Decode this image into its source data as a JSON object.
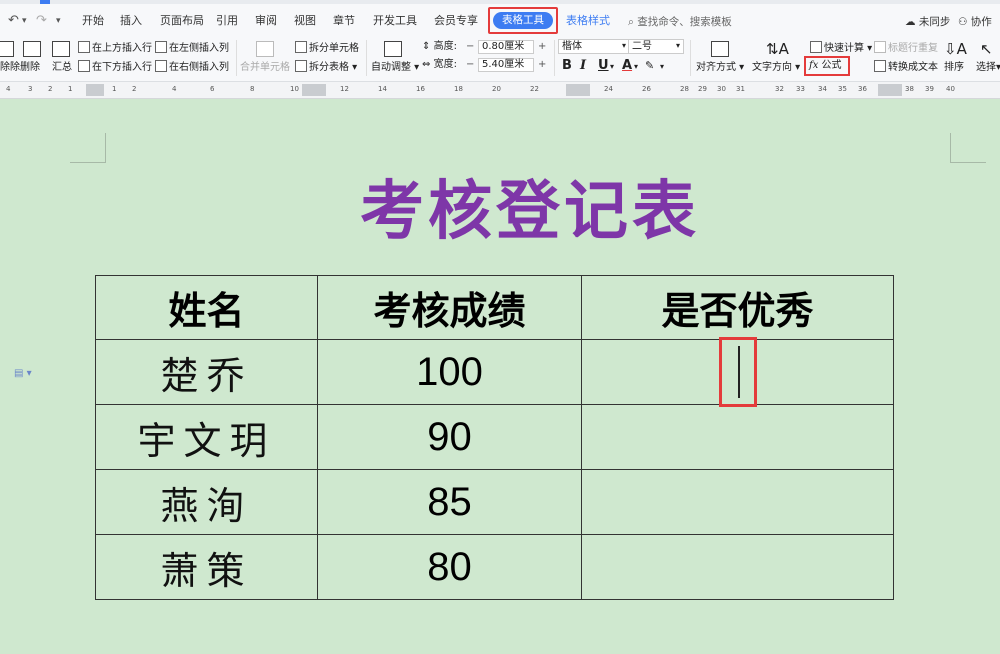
{
  "ribbon": {
    "tabs": [
      "开始",
      "插入",
      "页面布局",
      "引用",
      "审阅",
      "视图",
      "章节",
      "开发工具",
      "会员专享"
    ],
    "active_tab": "表格工具",
    "table_style_tab": "表格样式",
    "search_placeholder": "查找命令、搜索模板",
    "sync_label": "未同步",
    "collab_label": "协作",
    "tools": {
      "delete_partial": "除除",
      "delete": "删除",
      "summary": "汇总",
      "insert_row_above": "在上方插入行",
      "insert_row_below": "在下方插入行",
      "insert_col_left": "在左侧插入列",
      "insert_col_right": "在右侧插入列",
      "merge_cells": "合并单元格",
      "split_cells": "拆分单元格",
      "split_table": "拆分表格",
      "auto_adjust": "自动调整",
      "height_label": "高度:",
      "height_value": "0.80厘米",
      "width_label": "宽度:",
      "width_value": "5.40厘米",
      "font_name": "楷体",
      "font_size": "二号",
      "align": "对齐方式",
      "text_direction": "文字方向",
      "quick_calc": "快速计算",
      "formula": "公式",
      "header_repeat": "标题行重复",
      "convert_to_text": "转换成文本",
      "sort": "排序",
      "select": "选择"
    },
    "accent_color": "#3d7cf2",
    "highlight_color": "#e43b3b"
  },
  "ruler": {
    "marks": [
      "4",
      "3",
      "2",
      "1",
      "1",
      "2",
      "4",
      "6",
      "8",
      "10",
      "12",
      "14",
      "16",
      "18",
      "20",
      "22",
      "24",
      "26",
      "28",
      "29",
      "30",
      "31",
      "32",
      "33",
      "34",
      "35",
      "36",
      "38",
      "39",
      "40"
    ]
  },
  "document": {
    "title": "考核登记表",
    "title_color": "#7e36a8",
    "headers": [
      "姓名",
      "考核成绩",
      "是否优秀"
    ],
    "rows": [
      {
        "name": "楚乔",
        "score": "100",
        "excellent": ""
      },
      {
        "name": "宇文玥",
        "score": "90",
        "excellent": ""
      },
      {
        "name": "燕洵",
        "score": "85",
        "excellent": ""
      },
      {
        "name": "萧策",
        "score": "80",
        "excellent": ""
      }
    ]
  }
}
